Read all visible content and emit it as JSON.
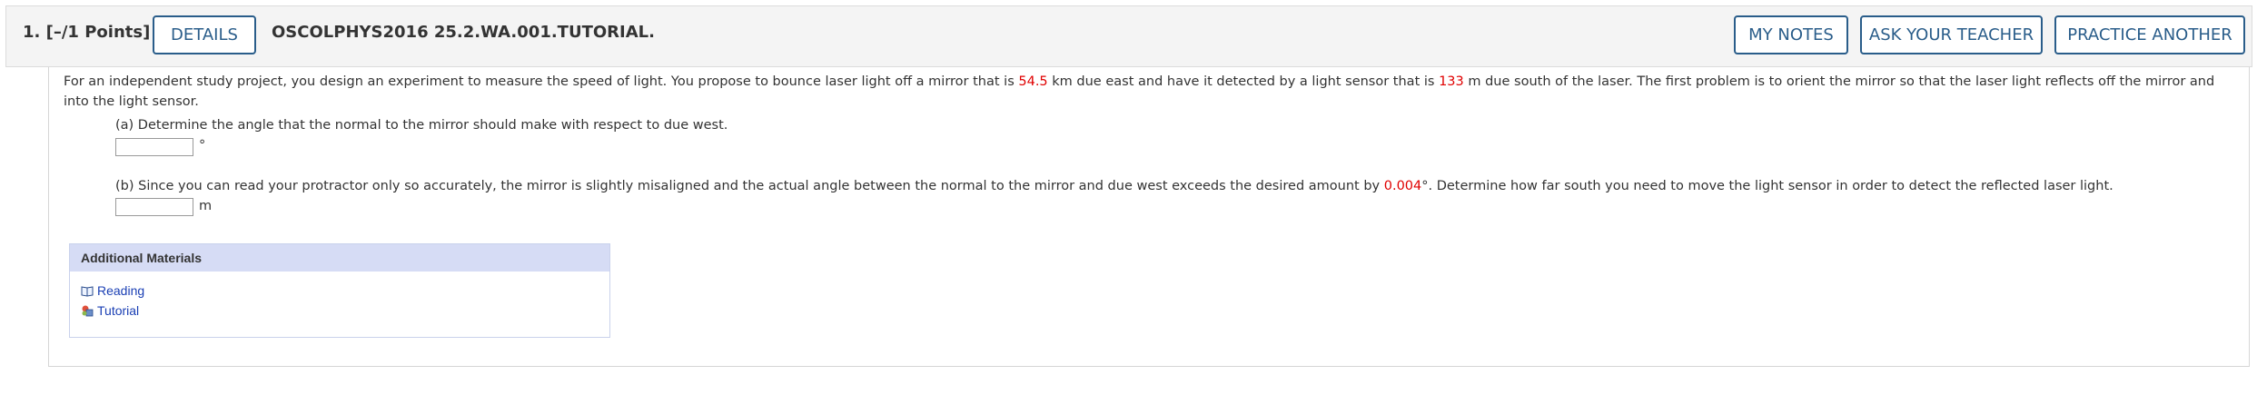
{
  "question": {
    "number_points": "1.  [–/1 Points]",
    "details_label": "DETAILS",
    "title": "OSCOLPHYS2016 25.2.WA.001.TUTORIAL.",
    "my_notes_label": "MY NOTES",
    "ask_teacher_label": "ASK YOUR TEACHER",
    "practice_label": "PRACTICE ANOTHER"
  },
  "problem": {
    "text_1": "For an independent study project, you design an experiment to measure the speed of light. You propose to bounce laser light off a mirror that is ",
    "value_1": "54.5",
    "text_2": " km due east and have it detected by a light sensor that is ",
    "value_2": "133",
    "text_3": " m due south of the laser. The first problem is to orient the mirror so that the laser light reflects off the mirror and into the light sensor."
  },
  "part_a": {
    "prompt": "(a) Determine the angle that the normal to the mirror should make with respect to due west.",
    "answer": "",
    "unit": "°"
  },
  "part_b": {
    "text_1": "(b) Since you can read your protractor only so accurately, the mirror is slightly misaligned and the actual angle between the normal to the mirror and due west exceeds the desired amount by ",
    "value": "0.004",
    "text_2": "°. Determine how far south you need to move the light sensor in order to detect the reflected laser light.",
    "answer": "",
    "unit": "m"
  },
  "additional_materials": {
    "heading": "Additional Materials",
    "links": [
      {
        "label": "Reading",
        "icon": "book-icon"
      },
      {
        "label": "Tutorial",
        "icon": "tutorial-icon"
      }
    ]
  }
}
